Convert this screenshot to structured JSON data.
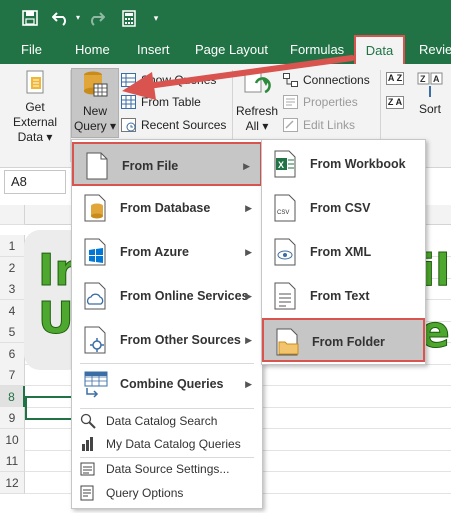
{
  "quick_access": {
    "save_icon": "save-icon",
    "undo_icon": "undo-icon",
    "redo_icon": "redo-icon",
    "calc_icon": "calculator-icon"
  },
  "tabs": [
    {
      "label": "File"
    },
    {
      "label": "Home"
    },
    {
      "label": "Insert"
    },
    {
      "label": "Page Layout"
    },
    {
      "label": "Formulas"
    },
    {
      "label": "Data"
    },
    {
      "label": "Revie"
    }
  ],
  "ribbon": {
    "get_external_data": "Get External",
    "get_external_data_2": "Data",
    "new_query": "New",
    "new_query_2": "Query",
    "show_queries": "Show Queries",
    "from_table": "From Table",
    "recent_sources": "Recent Sources",
    "refresh": "Refresh",
    "refresh_2": "All",
    "connections": "Connections",
    "properties": "Properties",
    "edit_links": "Edit Links",
    "sort": "Sort",
    "sort_az": "A Z",
    "sort_za": "Z A"
  },
  "formula_bar": {
    "name_box": "A8"
  },
  "grid": {
    "rows": [
      "1",
      "2",
      "3",
      "4",
      "5",
      "6",
      "7",
      "8",
      "9",
      "10",
      "11",
      "12"
    ],
    "banner_line1_a": "Ir",
    "banner_line1_b": "il",
    "banner_line2_a": "U",
    "banner_line2_b": "e"
  },
  "menu_new_query": {
    "items": [
      {
        "label": "From File",
        "icon": "file-icon"
      },
      {
        "label": "From Database",
        "icon": "database-icon"
      },
      {
        "label": "From Azure",
        "icon": "windows-icon"
      },
      {
        "label": "From Online Services",
        "icon": "cloud-icon"
      },
      {
        "label": "From Other Sources",
        "icon": "other-sources-icon"
      },
      {
        "label": "Combine Queries",
        "icon": "combine-icon"
      }
    ],
    "small_items": [
      {
        "label": "Data Catalog Search",
        "icon": "catalog-search-icon"
      },
      {
        "label": "My Data Catalog Queries",
        "icon": "catalog-queries-icon"
      },
      {
        "label": "Data Source Settings...",
        "icon": "settings-icon"
      },
      {
        "label": "Query Options",
        "icon": "query-options-icon"
      }
    ]
  },
  "menu_from_file": {
    "items": [
      {
        "label": "From Workbook",
        "icon": "excel-workbook-icon"
      },
      {
        "label": "From CSV",
        "icon": "csv-icon"
      },
      {
        "label": "From XML",
        "icon": "xml-icon"
      },
      {
        "label": "From Text",
        "icon": "text-file-icon"
      },
      {
        "label": "From Folder",
        "icon": "folder-icon"
      }
    ]
  },
  "colors": {
    "excel_green": "#217346",
    "highlight_red": "#d9534f",
    "banner_green": "#4ea72e"
  }
}
